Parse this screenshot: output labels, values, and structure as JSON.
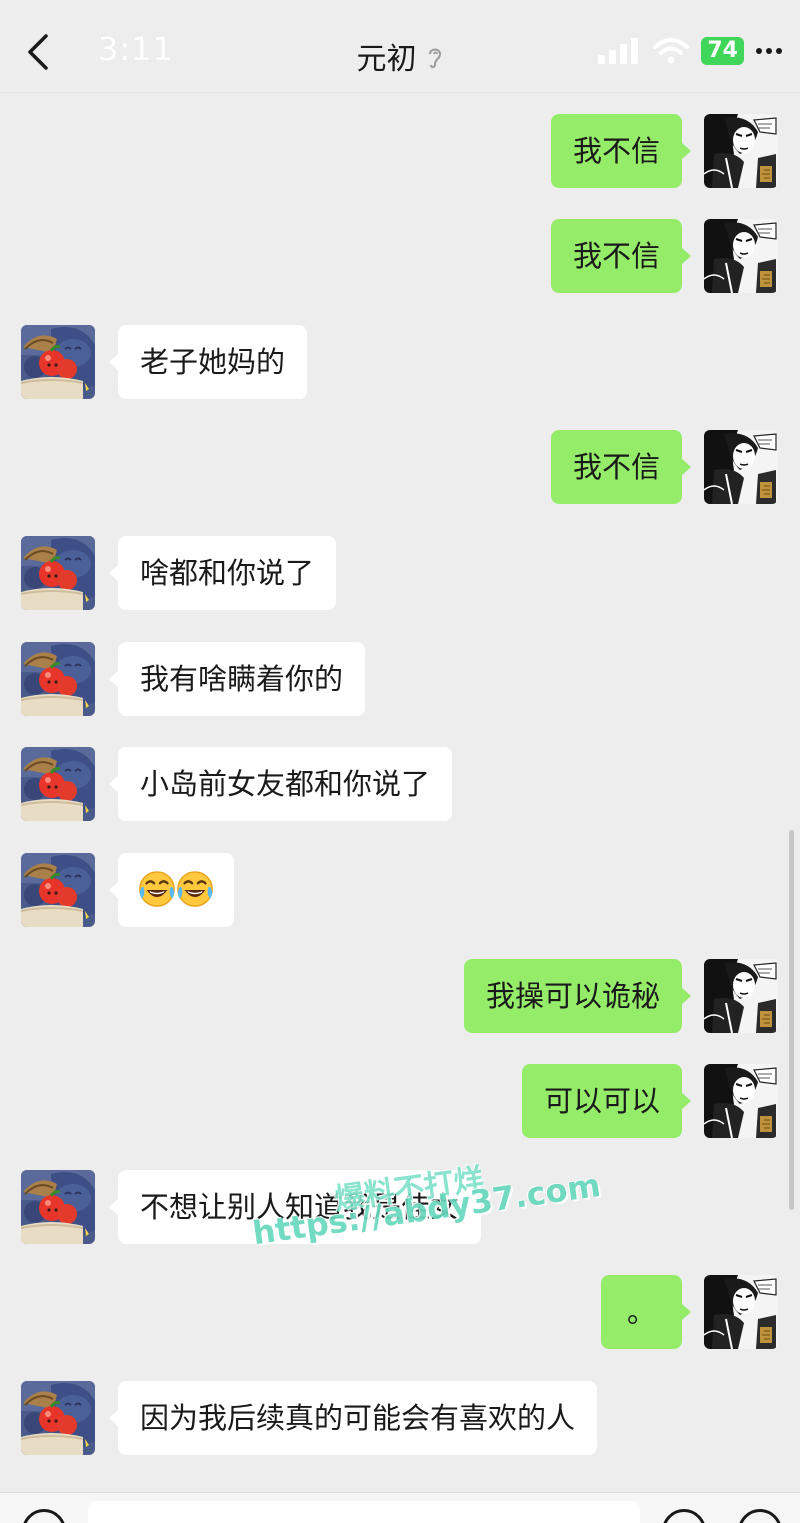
{
  "status_bar": {
    "time": "3:11",
    "battery": "74"
  },
  "header": {
    "title": "元初"
  },
  "messages": [
    {
      "side": "out",
      "text": "我不信"
    },
    {
      "side": "out",
      "text": "我不信"
    },
    {
      "side": "in",
      "text": "老子她妈的"
    },
    {
      "side": "out",
      "text": "我不信"
    },
    {
      "side": "in",
      "text": "啥都和你说了"
    },
    {
      "side": "in",
      "text": "我有啥瞒着你的"
    },
    {
      "side": "in",
      "text": "小岛前女友都和你说了"
    },
    {
      "side": "in",
      "emoji": "laughing-tears",
      "count": 2
    },
    {
      "side": "out",
      "text": "我操可以诡秘"
    },
    {
      "side": "out",
      "text": "可以可以"
    },
    {
      "side": "in",
      "text": "不想让别人知道我是佳女"
    },
    {
      "side": "out",
      "text": "。"
    },
    {
      "side": "in",
      "text": "因为我后续真的可能会有喜欢的人"
    }
  ],
  "watermark": {
    "line1": "爆料不打烊",
    "line2": "https://abdy37.com"
  },
  "colors": {
    "background": "#ededed",
    "outgoing_bubble": "#95ec69",
    "incoming_bubble": "#ffffff",
    "battery": "#3fd65a"
  }
}
